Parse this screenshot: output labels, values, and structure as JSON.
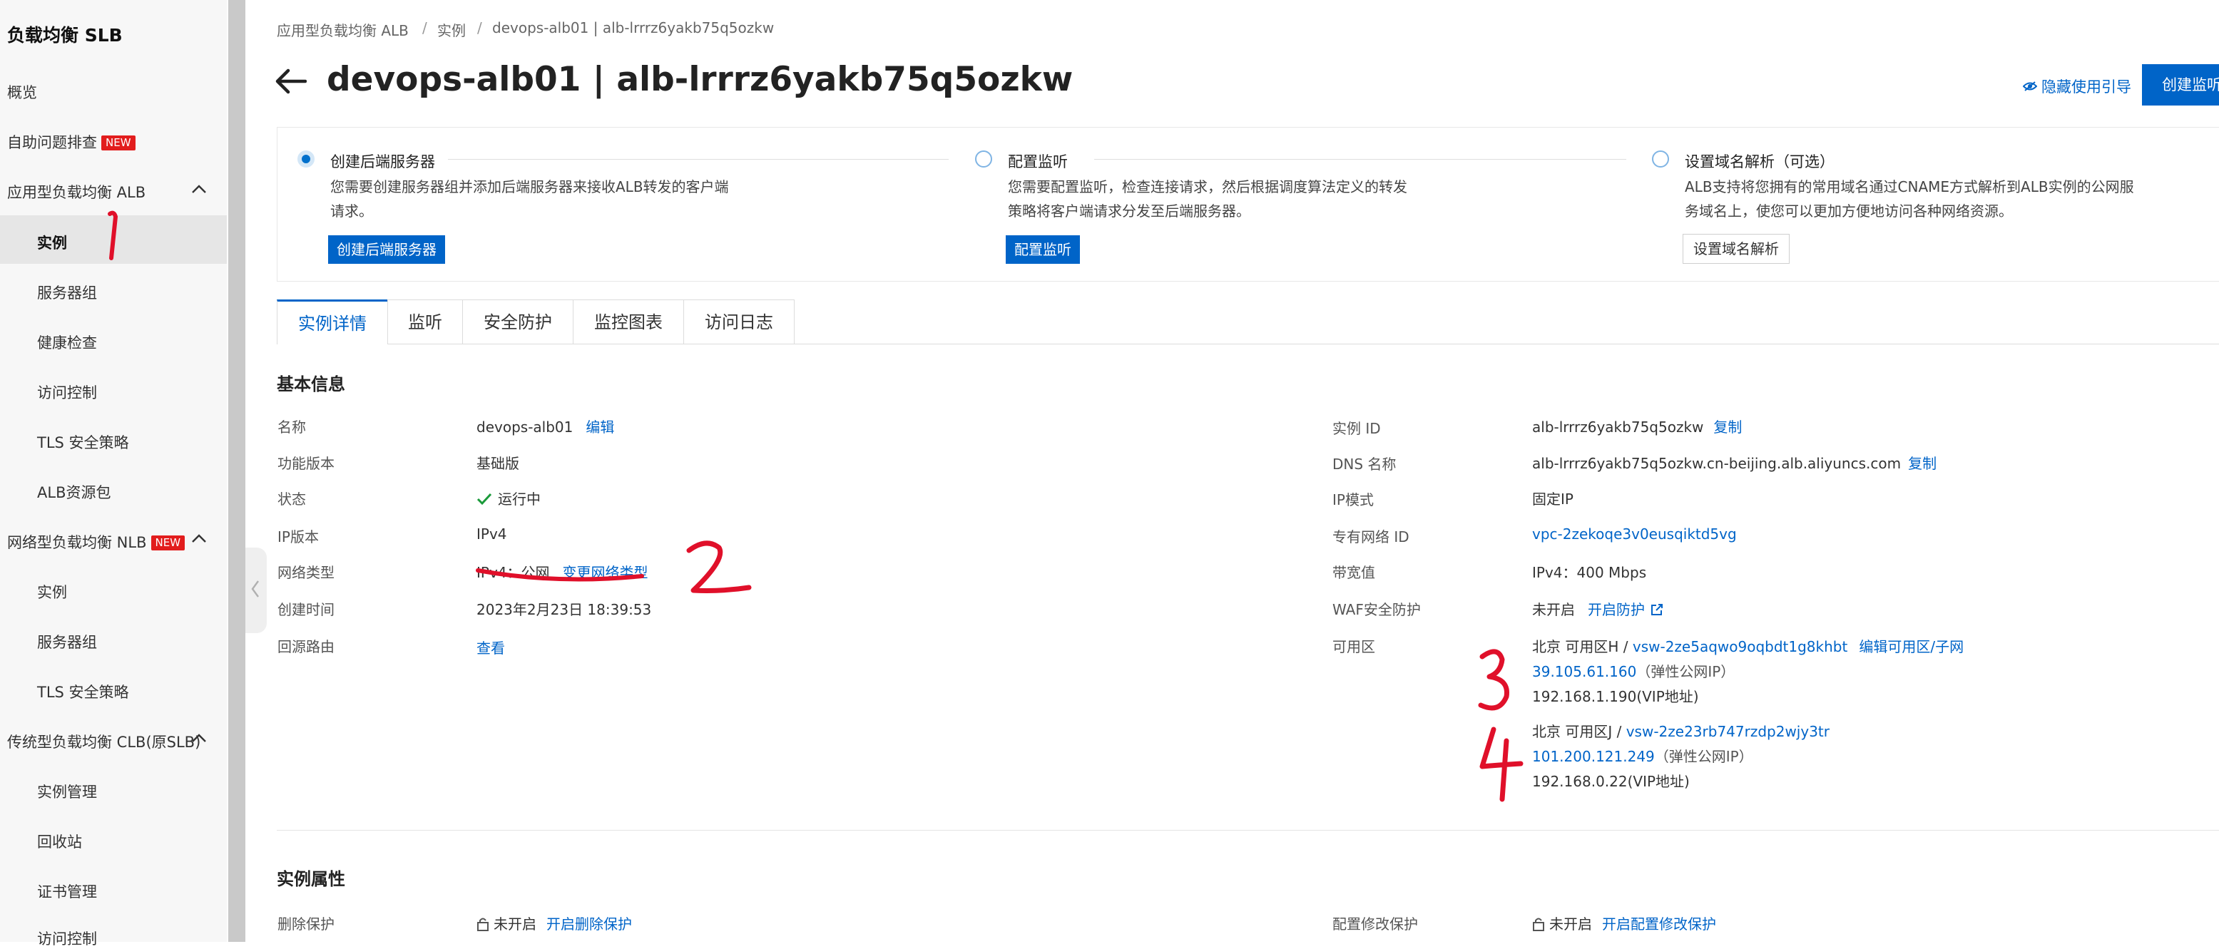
{
  "sidebar": {
    "title": "负载均衡 SLB",
    "overview": "概览",
    "self_check": "自助问题排查",
    "new_badge": "NEW",
    "alb": {
      "label": "应用型负载均衡 ALB",
      "items": [
        "实例",
        "服务器组",
        "健康检查",
        "访问控制",
        "TLS 安全策略",
        "ALB资源包"
      ]
    },
    "nlb": {
      "label": "网络型负载均衡 NLB",
      "items": [
        "实例",
        "服务器组",
        "TLS 安全策略"
      ]
    },
    "clb": {
      "label": "传统型负载均衡 CLB(原SLB)",
      "items": [
        "实例管理",
        "回收站",
        "证书管理",
        "访问控制"
      ]
    }
  },
  "breadcrumb": [
    "应用型负载均衡 ALB",
    "实例",
    "devops-alb01 | alb-lrrrz6yakb75q5ozkw"
  ],
  "page_title": "devops-alb01 | alb-lrrrz6yakb75q5ozkw",
  "header": {
    "hide_guide": "隐藏使用引导",
    "create_listener": "创建监听"
  },
  "guide": {
    "steps": [
      {
        "title": "创建后端服务器",
        "desc": "您需要创建服务器组并添加后端服务器来接收ALB转发的客户端请求。",
        "button": "创建后端服务器"
      },
      {
        "title": "配置监听",
        "desc": "您需要配置监听，检查连接请求，然后根据调度算法定义的转发策略将客户端请求分发至后端服务器。",
        "button": "配置监听"
      },
      {
        "title": "设置域名解析（可选）",
        "desc": "ALB支持将您拥有的常用域名通过CNAME方式解析到ALB实例的公网服务域名上，使您可以更加方便地访问各种网络资源。",
        "button": "设置域名解析"
      }
    ]
  },
  "tabs": [
    "实例详情",
    "监听",
    "安全防护",
    "监控图表",
    "访问日志"
  ],
  "basic_info": {
    "title": "基本信息",
    "left": {
      "name_label": "名称",
      "name": "devops-alb01",
      "edit": "编辑",
      "edition_label": "功能版本",
      "edition": "基础版",
      "status_label": "状态",
      "status": "运行中",
      "ip_version_label": "IP版本",
      "ip_version": "IPv4",
      "network_type_label": "网络类型",
      "network_type": "IPv4：公网",
      "change_network": "变更网络类型",
      "created_label": "创建时间",
      "created": "2023年2月23日 18:39:53",
      "route_label": "回源路由",
      "route_view": "查看"
    },
    "right": {
      "instance_id_label": "实例 ID",
      "instance_id": "alb-lrrrz6yakb75q5ozkw",
      "copy": "复制",
      "dns_label": "DNS 名称",
      "dns": "alb-lrrrz6yakb75q5ozkw.cn-beijing.alb.aliyuncs.com",
      "ip_mode_label": "IP模式",
      "ip_mode": "固定IP",
      "vpc_label": "专有网络 ID",
      "vpc": "vpc-2zekoqe3v0eusqiktd5vg",
      "bandwidth_label": "带宽值",
      "bandwidth": "IPv4：400 Mbps",
      "waf_label": "WAF安全防护",
      "waf": "未开启",
      "waf_enable": "开启防护",
      "zone_label": "可用区",
      "zones": [
        {
          "zone": "北京 可用区H /",
          "vswitch": "vsw-2ze5aqwo9oqbdt1g8khbt",
          "edit": "编辑可用区/子网",
          "eip": "39.105.61.160",
          "eip_note": "（弹性公网IP）",
          "vip": "192.168.1.190(VIP地址)"
        },
        {
          "zone": "北京 可用区J /",
          "vswitch": "vsw-2ze23rb747rzdp2wjy3tr",
          "eip": "101.200.121.249",
          "eip_note": "（弹性公网IP）",
          "vip": "192.168.0.22(VIP地址)"
        }
      ]
    }
  },
  "attributes": {
    "title": "实例属性",
    "delete_protect_label": "删除保护",
    "delete_protect": "未开启",
    "delete_protect_enable": "开启删除保护",
    "config_protect_label": "配置修改保护",
    "config_protect": "未开启",
    "config_protect_enable": "开启配置修改保护"
  },
  "annotations": [
    "1",
    "2",
    "3",
    "4"
  ],
  "colors": {
    "accent": "#0064c8",
    "badge": "#e21d1d",
    "annotation": "#e0102a",
    "success": "#1a9a3a"
  }
}
